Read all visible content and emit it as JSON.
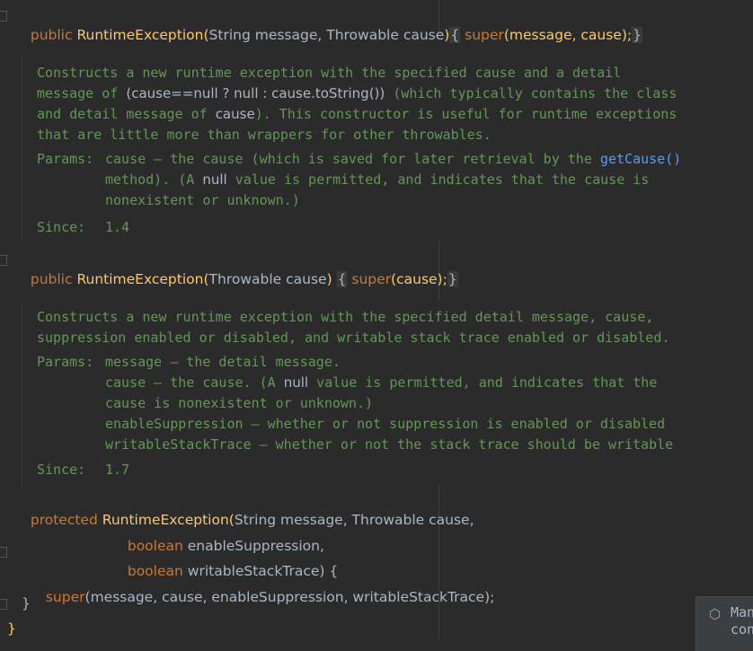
{
  "constructors": [
    {
      "signature": {
        "modifier": "public",
        "name": "RuntimeException",
        "open_paren": "(",
        "params": "String message, Throwable cause",
        "close_paren": ")",
        "body_pre": " { ",
        "super": "super",
        "args": "(message, cause);",
        "body_post": " }"
      },
      "doc": {
        "lines": [
          "Constructs a new runtime exception with the specified cause and a detail",
          "message of ",
          "and detail message of ",
          "that are little more than wrappers for other throwables."
        ],
        "inline_code": "(cause==null ? null : cause.toString())",
        "line2_suffix": " (which typically contains the class",
        "inline_cause": "cause",
        "line3_suffix": "). This constructor is useful for runtime exceptions",
        "params_label": "Params:",
        "params": [
          "cause – the cause (which is saved for later retrieval by the ",
          "method). (A ",
          "nonexistent or unknown.)"
        ],
        "link": "getCause()",
        "null_kw": "null",
        "param_line2_suffix": " value is permitted, and indicates that the cause is",
        "since_label": "Since:",
        "since_value": "1.4"
      }
    },
    {
      "signature": {
        "modifier": "public",
        "name": "RuntimeException",
        "open_paren": "(",
        "params": "Throwable cause",
        "close_paren": ")",
        "body_pre": " { ",
        "super": "super",
        "args": "(cause);",
        "body_post": " }"
      },
      "doc": {
        "lines": [
          "Constructs a new runtime exception with the specified detail message, cause,",
          "suppression enabled or disabled, and writable stack trace enabled or disabled."
        ],
        "params_label": "Params:",
        "params": [
          "message – the detail message.",
          "cause – the cause. (A ",
          "cause is nonexistent or unknown.)",
          "enableSuppression – whether or not suppression is enabled or disabled",
          "writableStackTrace – whether or not the stack trace should be writable"
        ],
        "null_kw": "null",
        "param_line2_suffix": " value is permitted, and indicates that the",
        "since_label": "Since:",
        "since_value": "1.7"
      }
    },
    {
      "signature": {
        "modifier": "protected",
        "name": "RuntimeException",
        "open_paren": "(",
        "params": "String message, Throwable cause,",
        "close_paren": ""
      },
      "continuation": [
        {
          "kw": "boolean",
          "text": " enableSuppression,"
        },
        {
          "kw": "boolean",
          "text": " writableStackTrace) {"
        }
      ],
      "body": {
        "super": "super",
        "args": "(message, cause, enableSuppression, writableStackTrace);"
      },
      "closing": "}"
    }
  ],
  "class_closing": "}",
  "popup": {
    "icon": "maven-icon",
    "icon_glyph": "⬡",
    "line1": "Man",
    "line2": "con"
  }
}
